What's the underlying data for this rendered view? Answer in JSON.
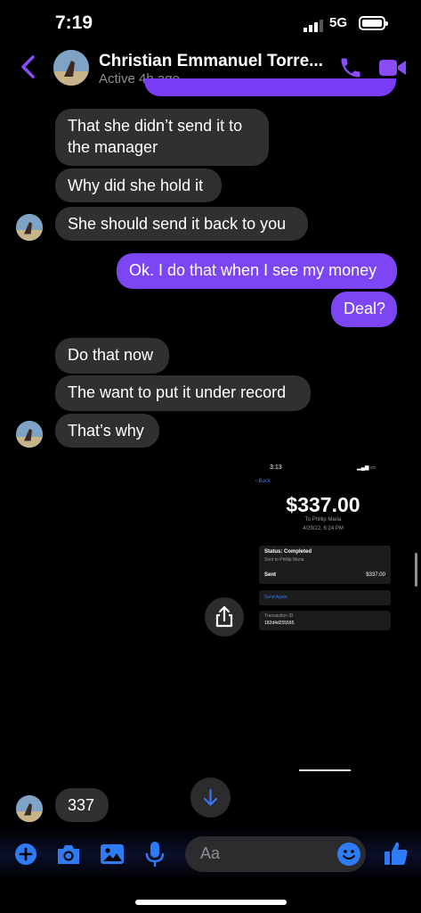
{
  "status_bar": {
    "time": "7:19",
    "network": "5G"
  },
  "header": {
    "contact_name": "Christian Emmanuel Torre...",
    "active_status": "Active 4h ago"
  },
  "messages": [
    {
      "from": "them",
      "text_lines": [
        "That she didn’t send it to",
        "the manager"
      ]
    },
    {
      "from": "them",
      "text": "Why did she hold it"
    },
    {
      "from": "them",
      "text": "She should send it back to you"
    },
    {
      "from": "me",
      "text": "Ok. I do that when I see my money"
    },
    {
      "from": "me",
      "text": "Deal?"
    },
    {
      "from": "them",
      "text": "Do that now"
    },
    {
      "from": "them",
      "text": "The want to put it under record"
    },
    {
      "from": "them",
      "text": "That’s why"
    },
    {
      "from": "them",
      "text": "337"
    }
  ],
  "receipt_image": {
    "time": "3:13",
    "back_label": "Back",
    "amount": "$337.00",
    "recipient": "To Phillip Maria",
    "date": "4/29/22, 6:24 PM",
    "status_label": "Status: Completed",
    "sent_to": "Sent to Phillip Maria",
    "sent_label": "Sent",
    "sent_value": "$337.00",
    "send_again": "Send Again",
    "transaction_label": "Transaction ID",
    "transaction_id": "182d4d255595"
  },
  "composer": {
    "placeholder": "Aa"
  },
  "colors": {
    "accent": "#7d46f5",
    "incoming_bubble": "#303030",
    "icon_blue": "#2e7bf6"
  }
}
